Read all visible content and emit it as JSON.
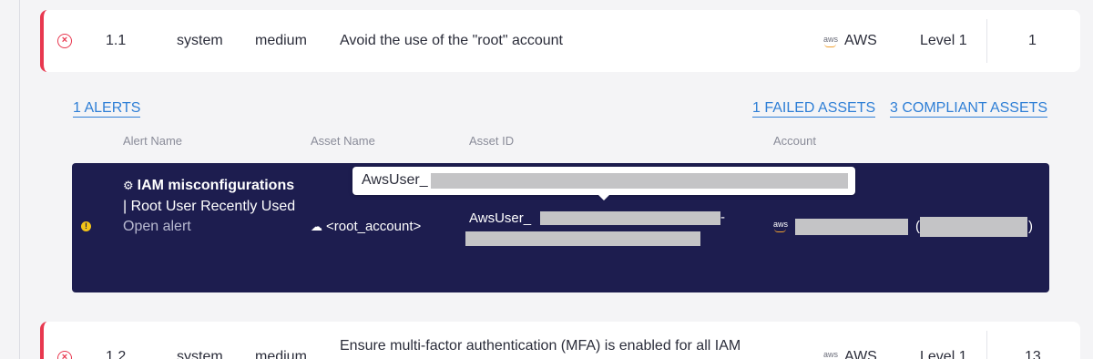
{
  "rules": [
    {
      "id": "1.1",
      "category": "system",
      "severity": "medium",
      "title": "Avoid the use of the \"root\" account",
      "provider_mini": "aws",
      "provider": "AWS",
      "level": "Level 1",
      "count": "1"
    },
    {
      "id": "1.2",
      "category": "system",
      "severity": "medium",
      "title": "Ensure multi-factor authentication (MFA) is enabled for all IAM",
      "provider_mini": "aws",
      "provider": "AWS",
      "level": "Level 1",
      "count": "13"
    }
  ],
  "links": {
    "alerts": "1 ALERTS",
    "failed_assets": "1 FAILED ASSETS",
    "compliant_assets": "3 COMPLIANT ASSETS"
  },
  "columns": {
    "alert_name": "Alert Name",
    "asset_name": "Asset Name",
    "asset_id": "Asset ID",
    "account": "Account"
  },
  "alert": {
    "severity_icon": "warning-dot-icon",
    "title_bold": "IAM misconfigurations",
    "title_rest": "| Root User Recently Used",
    "open_label": "Open alert",
    "asset_name": "<root_account>",
    "asset_id_prefix": "AwsUser_",
    "asset_id_separator": "-",
    "account_provider": "aws",
    "account_paren_open": "(",
    "account_paren_close": ")"
  },
  "tooltip": {
    "text": "AwsUser_"
  },
  "colors": {
    "fail_accent": "#e8384f",
    "card_bg": "#1d1d4f",
    "link": "#2f7fd6",
    "warning": "#f2c318"
  }
}
